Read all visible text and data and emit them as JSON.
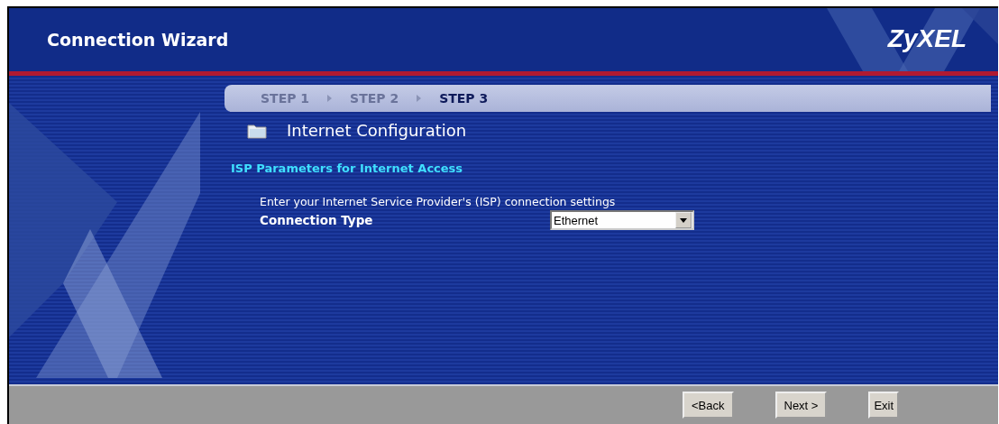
{
  "window": {
    "title": "Connection Wizard",
    "logo": "ZyXEL"
  },
  "steps": [
    {
      "label": "STEP 1",
      "selected": false
    },
    {
      "label": "STEP 2",
      "selected": false
    },
    {
      "label": "STEP 3",
      "selected": true
    }
  ],
  "section_title": "Internet Configuration",
  "subheading": "ISP Parameters for Internet Access",
  "instructions": "Enter your Internet Service Provider's (ISP) connection settings",
  "fields": [
    {
      "label": "Connection Type",
      "value": "Ethernet"
    }
  ],
  "buttons": [
    "<Back",
    "Next >",
    "Exit"
  ]
}
